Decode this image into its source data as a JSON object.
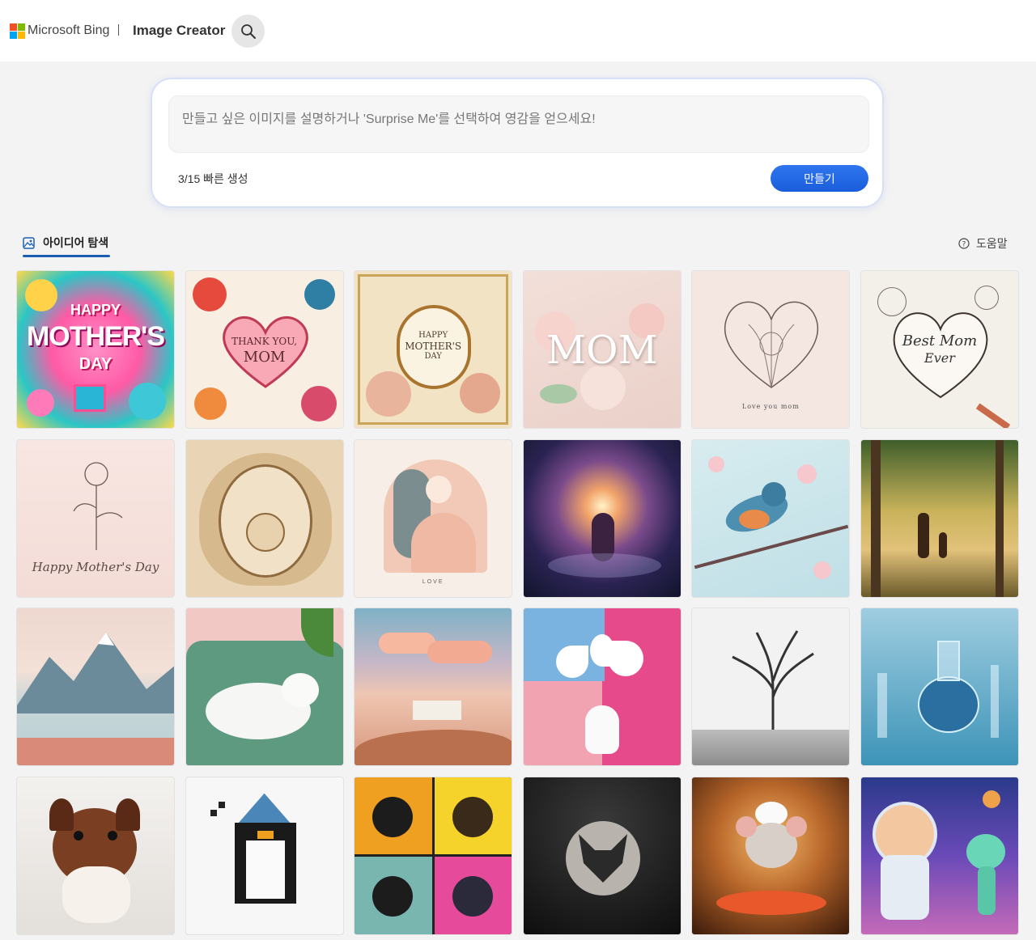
{
  "header": {
    "brand": "Microsoft Bing",
    "app_title": "Image Creator",
    "search_icon": "search-icon",
    "logo_colors": [
      "#f25022",
      "#7fba00",
      "#00a4ef",
      "#ffb900"
    ]
  },
  "prompt": {
    "placeholder": "만들고 싶은 이미지를 설명하거나 'Surprise Me'를 선택하여 영감을 얻으세요!",
    "value": "",
    "boost_text": "3/15 빠른 생성",
    "create_label": "만들기"
  },
  "explore": {
    "tab_label": "아이디어 탐색",
    "tab_icon": "image-icon",
    "help_label": "도움말",
    "help_icon": "question-circle-icon"
  },
  "tiles": [
    {
      "name": "happy-mothers-day-colorful",
      "icon": "image",
      "text": [
        "HAPPY",
        "MOTHER'S",
        "DAY"
      ]
    },
    {
      "name": "thank-you-mom-heart",
      "icon": "image",
      "text": [
        "THANK YOU,",
        "MOM"
      ]
    },
    {
      "name": "vintage-mothers-day-frame",
      "icon": "image",
      "text": [
        "HAPPY",
        "MOTHER'S",
        "DAY"
      ]
    },
    {
      "name": "mom-paper-flowers",
      "icon": "image",
      "text": [
        "MOM"
      ]
    },
    {
      "name": "love-you-mom-heart-sketch",
      "icon": "image",
      "text": [
        "Love you mom"
      ]
    },
    {
      "name": "best-mom-ever-heart",
      "icon": "image",
      "text": [
        "Best Mom",
        "Ever"
      ]
    },
    {
      "name": "rose-line-art",
      "icon": "image",
      "text": [
        "Happy Mother's Day"
      ]
    },
    {
      "name": "paper-cut-mother-child",
      "icon": "image",
      "text": []
    },
    {
      "name": "mother-baby-illustration",
      "icon": "image",
      "text": [
        "LOVE"
      ]
    },
    {
      "name": "cosmic-mother-child",
      "icon": "image",
      "text": []
    },
    {
      "name": "bird-cherry-blossom",
      "icon": "image",
      "text": []
    },
    {
      "name": "forest-walk-painting",
      "icon": "image",
      "text": []
    },
    {
      "name": "mountain-lake-painting",
      "icon": "image",
      "text": []
    },
    {
      "name": "white-cat-sofa",
      "icon": "image",
      "text": []
    },
    {
      "name": "desert-house-clouds",
      "icon": "image",
      "text": []
    },
    {
      "name": "calla-lily-vase",
      "icon": "image",
      "text": []
    },
    {
      "name": "ink-tree-forest",
      "icon": "image",
      "text": []
    },
    {
      "name": "blue-flask",
      "icon": "image",
      "text": []
    },
    {
      "name": "fluffy-puppy",
      "icon": "image",
      "text": []
    },
    {
      "name": "pixel-penguin-wizard",
      "icon": "image",
      "text": []
    },
    {
      "name": "pop-art-chihuahuas",
      "icon": "image",
      "text": []
    },
    {
      "name": "fox-logo",
      "icon": "image",
      "text": []
    },
    {
      "name": "mouse-chef",
      "icon": "image",
      "text": []
    },
    {
      "name": "space-kid-alien",
      "icon": "image",
      "text": []
    }
  ]
}
